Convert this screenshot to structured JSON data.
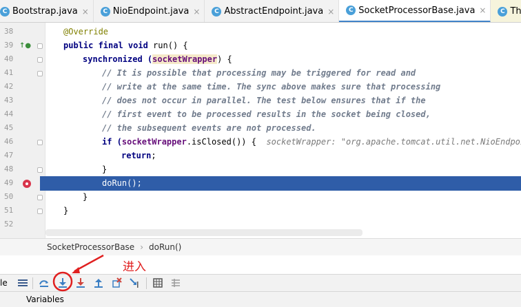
{
  "tabs": [
    {
      "label": "Bootstrap.java",
      "icon": "class-icon",
      "active": false
    },
    {
      "label": "NioEndpoint.java",
      "icon": "class-icon",
      "active": false
    },
    {
      "label": "AbstractEndpoint.java",
      "icon": "class-icon",
      "active": false
    },
    {
      "label": "SocketProcessorBase.java",
      "icon": "class-icon",
      "active": true
    },
    {
      "label": "Thread.java",
      "icon": "class-icon",
      "active": false
    }
  ],
  "line_numbers": [
    "38",
    "39",
    "40",
    "41",
    "42",
    "43",
    "44",
    "45",
    "46",
    "47",
    "48",
    "49",
    "50",
    "51",
    "52"
  ],
  "code": {
    "l38": "@Override",
    "l39_a": "public final void ",
    "l39_b": "run() {",
    "l40_a": "synchronized (",
    "l40_b": "socketWrapper",
    "l40_c": ") {",
    "l41": "// It is possible that processing may be triggered for read and",
    "l42": "// write at the same time. The sync above makes sure that processing",
    "l43": "// does not occur in parallel. The test below ensures that if the",
    "l44": "// first event to be processed results in the socket being closed,",
    "l45": "// the subsequent events are not processed.",
    "l46_a": "if (",
    "l46_b": "socketWrapper",
    "l46_c": ".isClosed()) {",
    "l46_hint": "socketWrapper: \"org.apache.tomcat.util.net.NioEndpoint",
    "l47_a": "return",
    "l47_b": ";",
    "l48": "}",
    "l49": "doRun();",
    "l50": "}",
    "l51": "}"
  },
  "breadcrumb": {
    "class": "SocketProcessorBase",
    "method": "doRun()"
  },
  "annotation": {
    "text": "进入",
    "color": "#e02020"
  },
  "toolbar": {
    "label": "le",
    "buttons": [
      "show-execution-point-icon",
      "step-over-icon",
      "step-into-icon",
      "force-step-into-icon",
      "step-out-icon",
      "drop-frame-icon",
      "run-to-cursor-icon",
      "evaluate-expression-icon",
      "trace-icon"
    ]
  },
  "panel": {
    "variables_label": "Variables"
  },
  "colors": {
    "highlight": "#2f5da8",
    "breakpoint": "#d8344b",
    "keyword": "#000080",
    "comment": "#808080",
    "annotation_red": "#e02020"
  }
}
